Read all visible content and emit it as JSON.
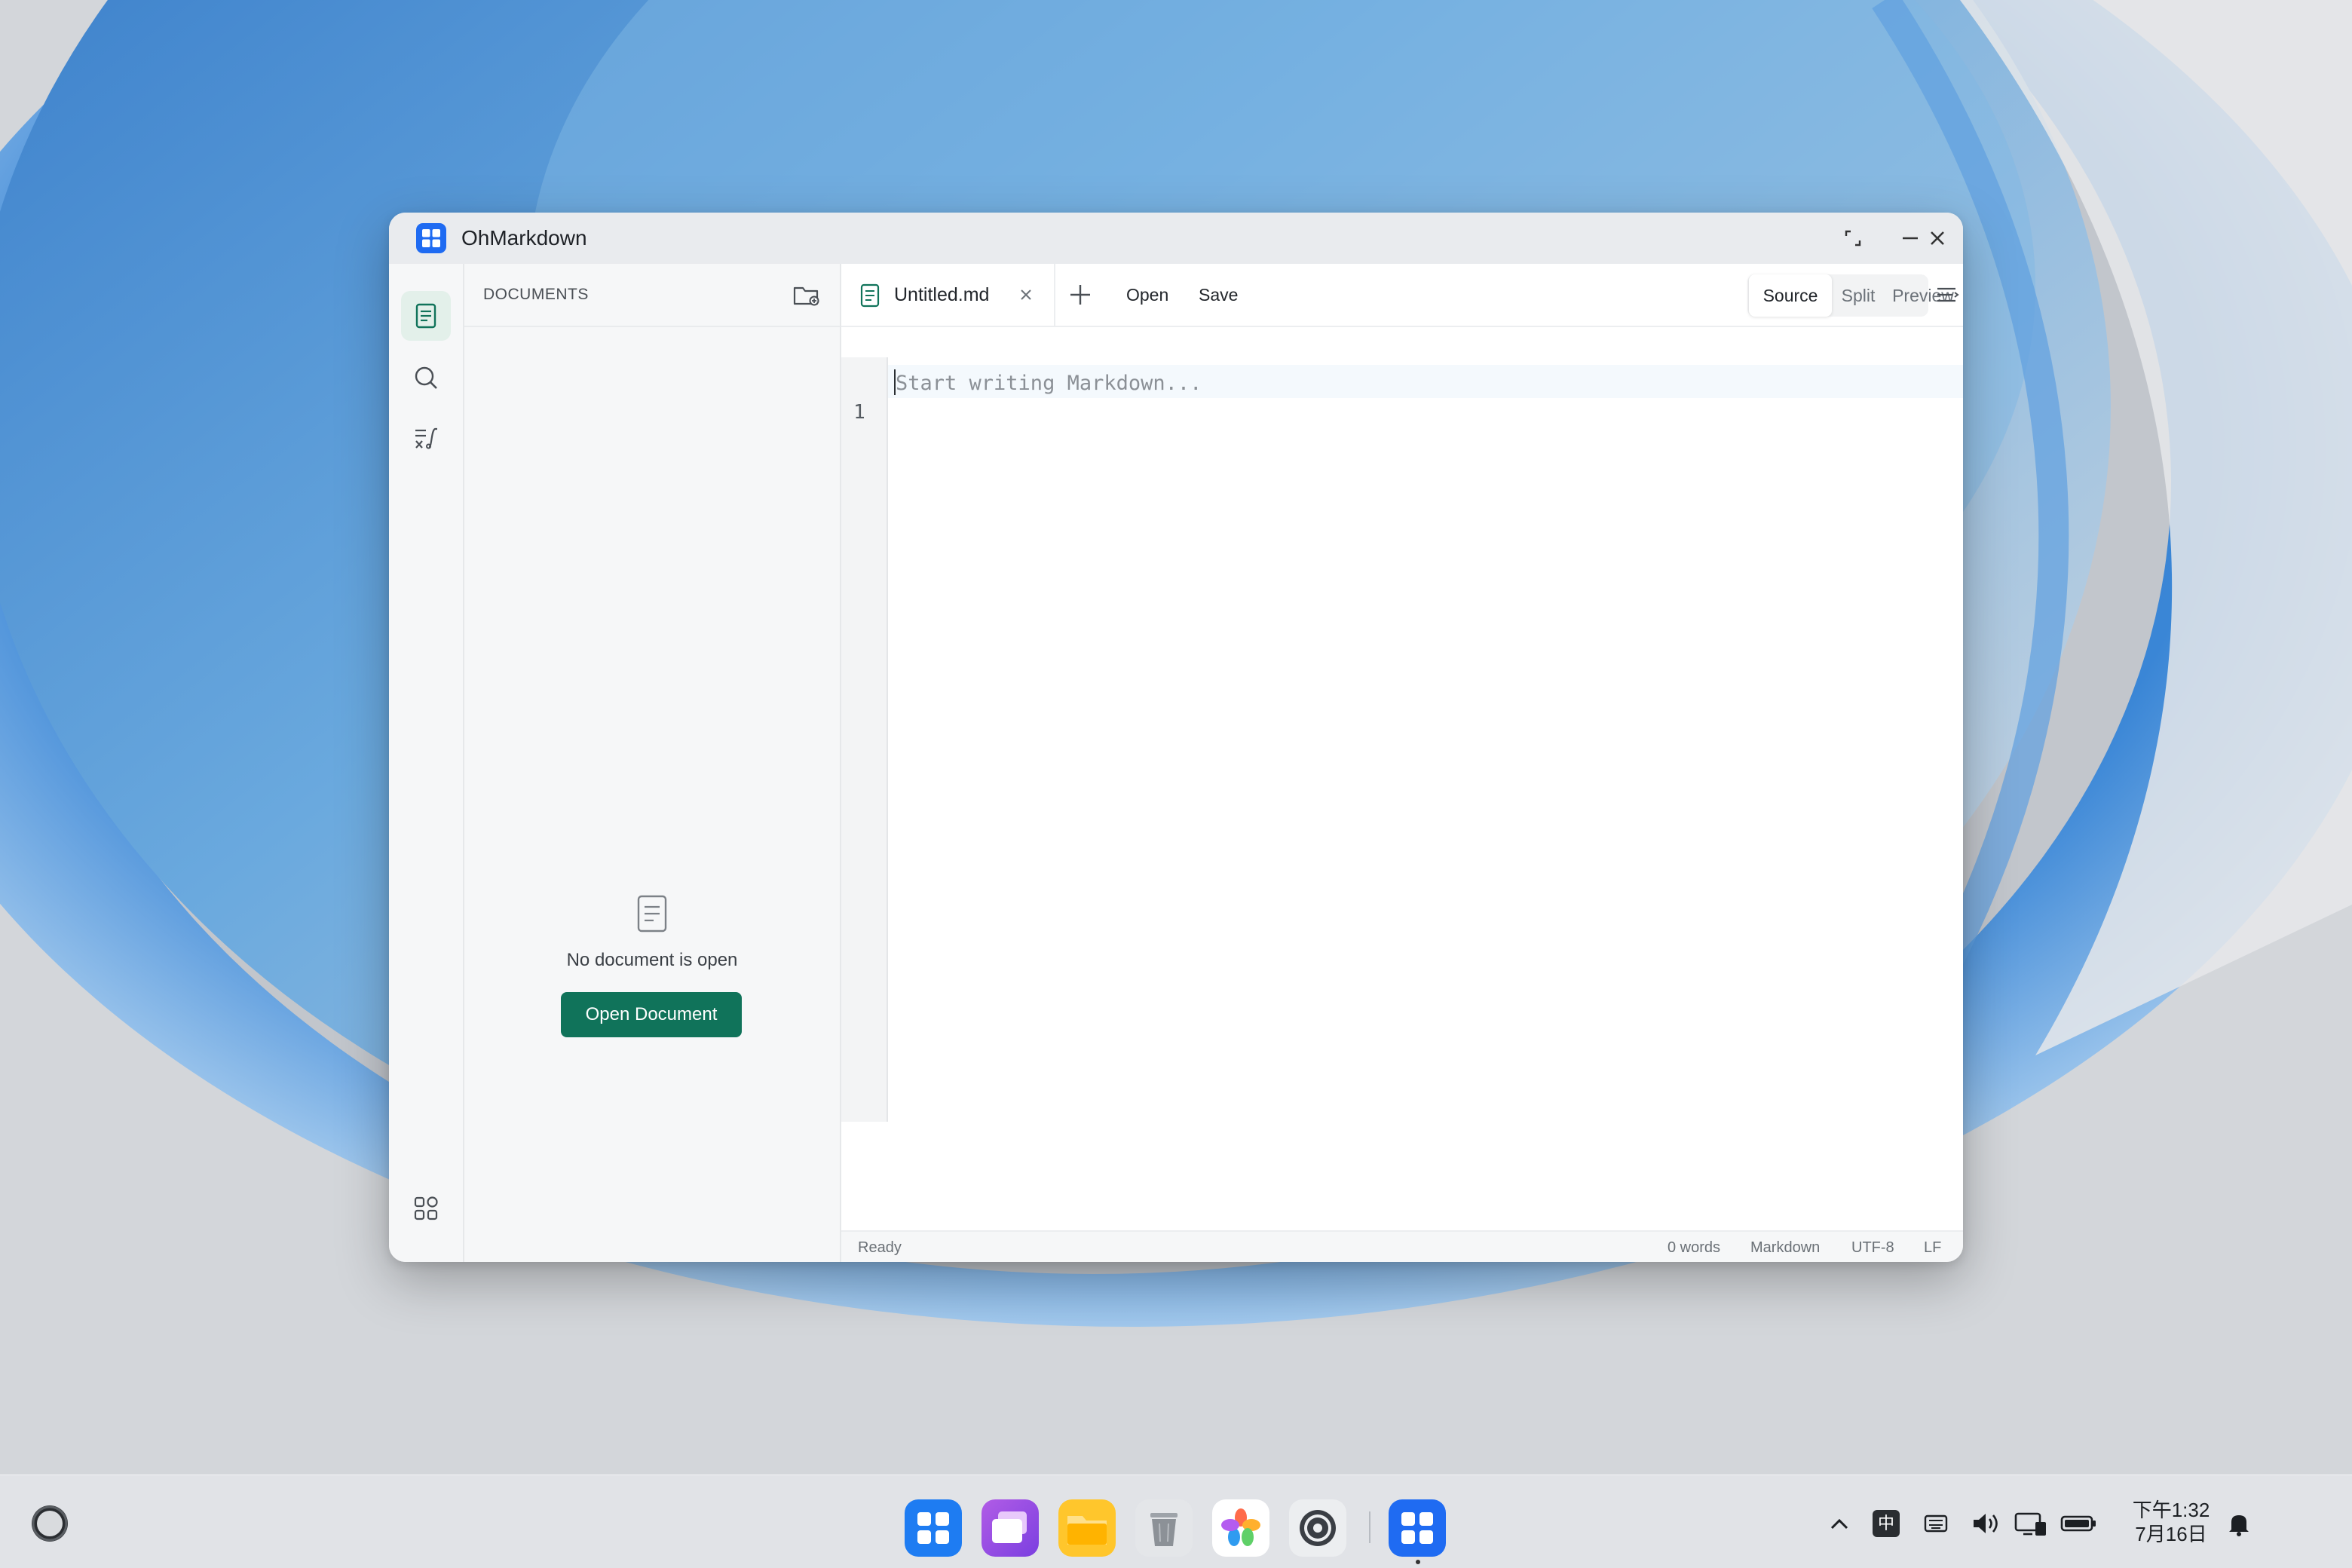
{
  "window": {
    "title": "OhMarkdown"
  },
  "colors": {
    "accent": "#10735a",
    "active_nav_bg": "#e3f0ea",
    "dock_app_blue": "#1f6bf2"
  },
  "activity_bar": {
    "items": [
      {
        "name": "documents",
        "icon": "document-icon",
        "active": true
      },
      {
        "name": "search",
        "icon": "search-icon",
        "active": false
      },
      {
        "name": "math",
        "icon": "math-formula-icon",
        "active": false
      }
    ],
    "bottom_icon": "apps-grid-icon"
  },
  "documents_panel": {
    "title": "DOCUMENTS",
    "empty_text": "No document is open",
    "open_button": "Open Document"
  },
  "tabs": [
    {
      "label": "Untitled.md",
      "active": true
    }
  ],
  "toolbar": {
    "open_label": "Open",
    "save_label": "Save"
  },
  "view_modes": {
    "options": [
      "Source",
      "Split",
      "Preview"
    ],
    "selected": "Source",
    "source": "Source",
    "split": "Split",
    "preview": "Preview"
  },
  "editor": {
    "line_number": "1",
    "placeholder": "Start writing Markdown..."
  },
  "status": {
    "state": "Ready",
    "words": "0 words",
    "language": "Markdown",
    "encoding": "UTF-8",
    "line_ending": "LF"
  },
  "taskbar": {
    "dock": [
      "app-grid-icon",
      "multitask-icon",
      "files-icon",
      "trash-icon",
      "photos-icon",
      "settings-icon",
      "ohmarkdown-icon"
    ],
    "tray": {
      "ime": "中",
      "time": "下午1:32",
      "date": "7月16日"
    }
  }
}
